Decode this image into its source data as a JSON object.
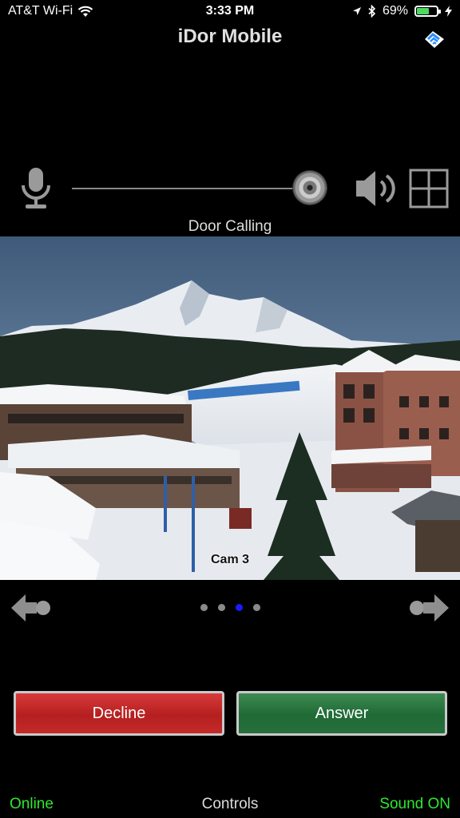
{
  "status_bar": {
    "carrier": "AT&T Wi-Fi",
    "time": "3:33 PM",
    "battery_percent": "69%",
    "battery_level": 0.69,
    "icons": [
      "wifi-icon",
      "location-arrow-icon",
      "bluetooth-icon",
      "battery-icon",
      "charging-bolt-icon"
    ]
  },
  "nav": {
    "title": "iDor Mobile",
    "right_icon": "app-logo-icon"
  },
  "audio": {
    "mic_icon": "microphone-icon",
    "speaker_icon": "speaker-icon",
    "layout_icon": "grid-layout-icon",
    "volume_level": 0.93
  },
  "call": {
    "status": "Door Calling"
  },
  "camera": {
    "label": "Cam 3"
  },
  "pager": {
    "total": 4,
    "active_index": 2,
    "prev_icon": "arrow-left-icon",
    "next_icon": "arrow-right-icon"
  },
  "actions": {
    "decline_label": "Decline",
    "answer_label": "Answer",
    "decline_color": "#c42a2a",
    "answer_color": "#276f3c"
  },
  "footer": {
    "online_label": "Online",
    "controls_label": "Controls",
    "sound_label": "Sound ON",
    "status_color": "#2ee82e"
  }
}
